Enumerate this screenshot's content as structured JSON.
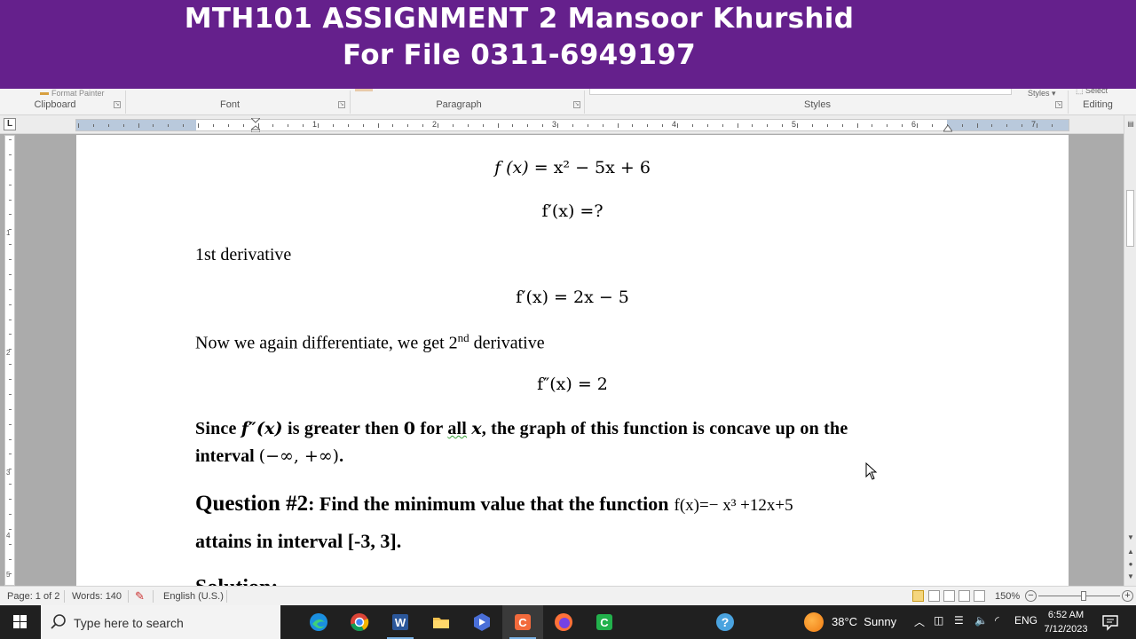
{
  "banner": {
    "line1": "MTH101 ASSIGNMENT 2 Mansoor Khurshid",
    "line2": "For File 0311-6949197"
  },
  "ribbon": {
    "clipboard_cut": "Format Painter",
    "groups": {
      "clipboard": "Clipboard",
      "font": "Font",
      "paragraph": "Paragraph",
      "styles": "Styles",
      "editing": "Editing"
    },
    "styles_more": "Styles ▾",
    "select": "Select"
  },
  "ruler": {
    "numbers": [
      "1",
      "2",
      "3",
      "4",
      "5",
      "6",
      "7"
    ],
    "tab_selector": "L"
  },
  "vruler": {
    "numbers": [
      "1",
      "2",
      "3",
      "4",
      "5"
    ]
  },
  "document": {
    "eq1": {
      "lhs": "f (x)",
      "rhs": "= x² − 5x + 6"
    },
    "eq2": "f′(x) =?",
    "derivative1_label": "1st derivative",
    "eq3": "f′(x) = 2x − 5",
    "second_deriv_text_pre": "Now we again differentiate, we get 2",
    "second_deriv_sup": "nd",
    "second_deriv_text_post": " derivative",
    "eq4": "f″(x) = 2",
    "concave": {
      "part1": "Since ",
      "fpp": "f″(x)",
      "part2": " is greater then ",
      "zero": "0",
      "part3": " for ",
      "all": "all",
      "x": "x",
      "part4": ", the graph of this function is concave up on the",
      "line2_pre": "interval ",
      "interval": "(−∞, +∞)",
      "line2_post": "."
    },
    "question2": {
      "label": "Question #2",
      "text": ": Find the minimum  value that the function",
      "function": "f(x)=− x³ +12x+5",
      "line2": "attains in interval  [-3, 3]."
    },
    "solution": "Solution:"
  },
  "statusbar": {
    "page": "Page: 1 of 2",
    "words": "Words: 140",
    "language": "English (U.S.)",
    "zoom": "150%"
  },
  "taskbar": {
    "search_placeholder": "Type here to search",
    "weather_temp": "38°C",
    "weather_cond": "Sunny",
    "lang": "ENG",
    "time": "6:52 AM",
    "date": "7/12/2023"
  },
  "colors": {
    "banner": "#65208c",
    "ribbon": "#f3f3f3",
    "taskbar": "#202020",
    "page_bg": "#ababab"
  }
}
